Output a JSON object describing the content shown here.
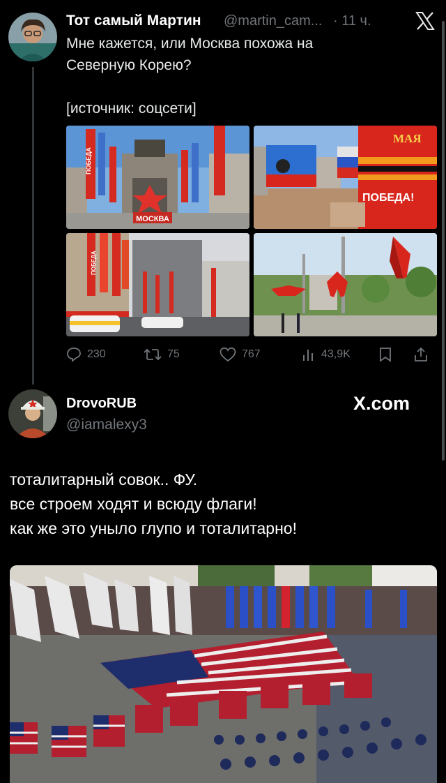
{
  "tweet": {
    "author_name": "Тот самый Мартин",
    "author_handle": "@martin_cam...",
    "time": "· 11 ч.",
    "text": "Мне кажется, или Москва похожа на\nСеверную Корею?\n\n[источник: соцсети]",
    "photos": [
      {
        "sign_top": "ПОБЕДА",
        "sign_bottom": "МОСКВА"
      },
      {
        "sign_top": "МАЯ",
        "sign_bottom": "ПОБЕДА!"
      },
      {
        "sign_top": "ПОБЕДА"
      },
      {}
    ],
    "stats": {
      "replies": "230",
      "retweets": "75",
      "likes": "767",
      "views": "43,9K"
    }
  },
  "reply": {
    "author_name": "DrovoRUB",
    "author_handle": "@iamalexy3",
    "brand": "X.com",
    "text": "тоталитарный совок.. ФУ.\nвсе строем ходят и всюду флаги!\nкак же это уныло глупо и тоталитарно!"
  },
  "colors": {
    "background": "#000000",
    "text": "#e7e9ea",
    "muted": "#71767b",
    "flag_red": "#d42a20"
  },
  "icons": [
    "x-logo-icon",
    "reply-icon",
    "retweet-icon",
    "like-icon",
    "views-icon",
    "bookmark-icon",
    "share-icon"
  ]
}
